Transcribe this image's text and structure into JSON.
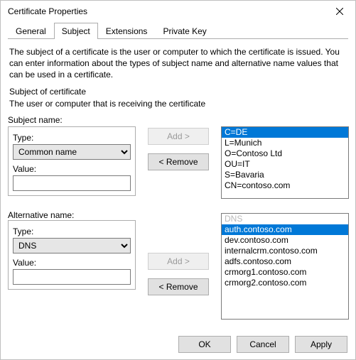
{
  "window": {
    "title": "Certificate Properties"
  },
  "tabs": [
    "General",
    "Subject",
    "Extensions",
    "Private Key"
  ],
  "active_tab_index": 1,
  "info_text": "The subject of a certificate is the user or computer to which the certificate is issued. You can enter information about the types of subject name and alternative name values that can be used in a certificate.",
  "section1_title": "Subject of certificate",
  "section1_desc": "The user or computer that is receiving the certificate",
  "subject": {
    "heading": "Subject name:",
    "type_label": "Type:",
    "type_value": "Common name",
    "value_label": "Value:",
    "value_text": "",
    "add_label": "Add >",
    "remove_label": "< Remove",
    "list": [
      "C=DE",
      "L=Munich",
      "O=Contoso Ltd",
      "OU=IT",
      "S=Bavaria",
      "CN=contoso.com"
    ],
    "selected_index": 0
  },
  "alt": {
    "heading": "Alternative name:",
    "type_label": "Type:",
    "type_value": "DNS",
    "value_label": "Value:",
    "value_text": "",
    "add_label": "Add >",
    "remove_label": "< Remove",
    "list_header": "DNS",
    "list": [
      "auth.contoso.com",
      "dev.contoso.com",
      "internalcrm.contoso.com",
      "adfs.contoso.com",
      "crmorg1.contoso.com",
      "crmorg2.contoso.com"
    ],
    "selected_index": 0
  },
  "buttons": {
    "ok": "OK",
    "cancel": "Cancel",
    "apply": "Apply"
  }
}
